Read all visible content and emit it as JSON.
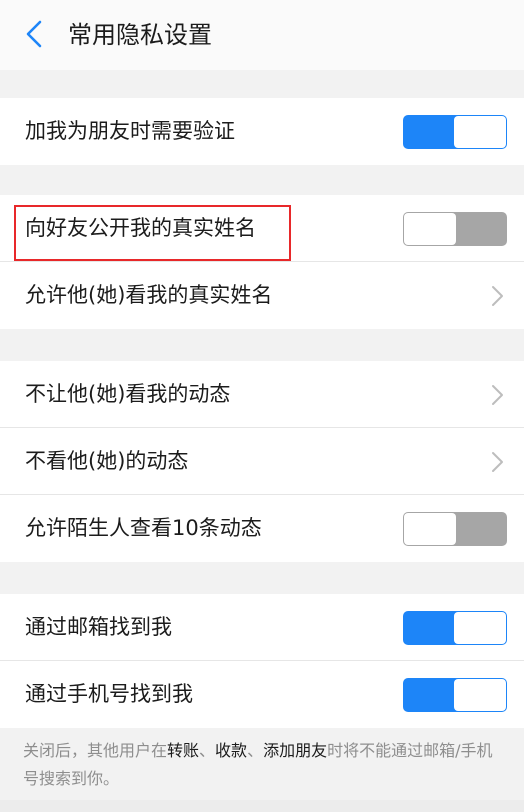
{
  "header": {
    "title": "常用隐私设置"
  },
  "groups": [
    {
      "rows": [
        {
          "label": "加我为朋友时需要验证",
          "control": "toggle",
          "on": true
        }
      ]
    },
    {
      "rows": [
        {
          "label": "向好友公开我的真实姓名",
          "control": "toggle",
          "on": false
        },
        {
          "label": "允许他(她)看我的真实姓名",
          "control": "chevron"
        }
      ]
    },
    {
      "rows": [
        {
          "label": "不让他(她)看我的动态",
          "control": "chevron"
        },
        {
          "label": "不看他(她)的动态",
          "control": "chevron"
        },
        {
          "label": "允许陌生人查看10条动态",
          "control": "toggle",
          "on": false
        }
      ]
    },
    {
      "rows": [
        {
          "label": "通过邮箱找到我",
          "control": "toggle",
          "on": true
        },
        {
          "label": "通过手机号找到我",
          "control": "toggle",
          "on": true
        }
      ]
    }
  ],
  "footer": {
    "prefix": "关闭后，其他用户在",
    "bold1": "转账",
    "sep1": "、",
    "bold2": "收款",
    "sep2": "、",
    "bold3": "添加朋友",
    "suffix": "时将不能通过邮箱/手机号搜索到你。"
  },
  "colors": {
    "accent": "#1d85f8",
    "toggle_off": "#a6a6a6",
    "highlight": "#e8282a"
  }
}
